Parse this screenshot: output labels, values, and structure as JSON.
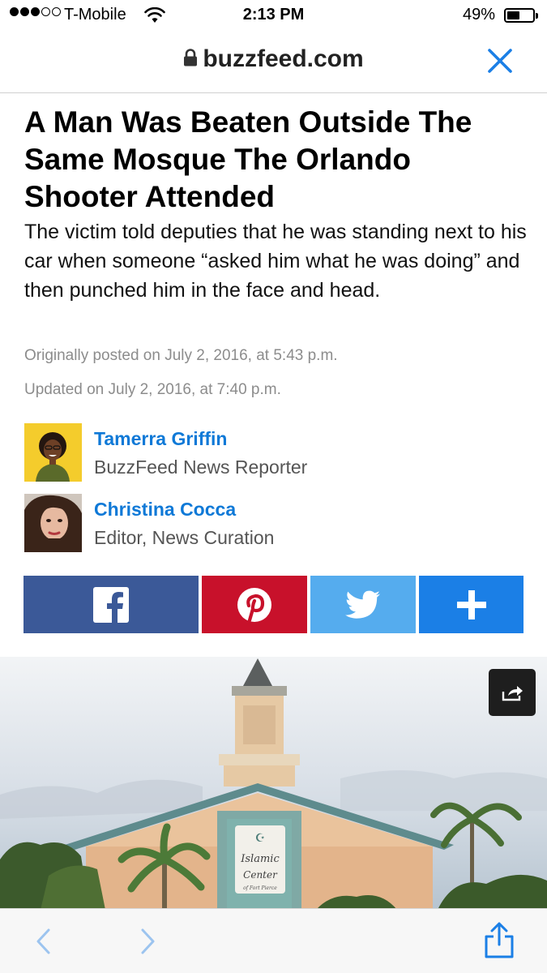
{
  "status_bar": {
    "carrier": "T-Mobile",
    "time": "2:13 PM",
    "battery_percent": "49%",
    "battery_level": 0.49,
    "signal_bars": 3,
    "signal_max": 5
  },
  "url_bar": {
    "domain": "buzzfeed.com",
    "icons": [
      "lock-icon",
      "close-icon"
    ]
  },
  "article": {
    "headline": "A Man Was Beaten Outside The Same Mosque The Orlando Shooter Attended",
    "dek": "The victim told deputies that he was standing next to his car when someone “asked him what he was doing” and then punched him in the face and head.",
    "posted": "Originally posted on July 2, 2016, at 5:43 p.m.",
    "updated": "Updated on July 2, 2016, at 7:40 p.m."
  },
  "bylines": [
    {
      "name": "Tamerra Griffin",
      "role": "BuzzFeed News Reporter"
    },
    {
      "name": "Christina Cocca",
      "role": "Editor, News Curation"
    }
  ],
  "share_buttons": [
    {
      "network": "facebook",
      "icon": "facebook-icon",
      "color": "#3b5998"
    },
    {
      "network": "pinterest",
      "icon": "pinterest-icon",
      "color": "#c8112b"
    },
    {
      "network": "twitter",
      "icon": "twitter-icon",
      "color": "#55acee"
    },
    {
      "network": "more",
      "icon": "plus-icon",
      "color": "#1b7fe6"
    }
  ],
  "hero_image": {
    "sign_line1": "Islamic",
    "sign_line2": "Center",
    "sign_line3": "of Fort Pierce"
  },
  "toolbar": {
    "icons": [
      "back-icon",
      "forward-icon",
      "share-icon"
    ]
  },
  "colors": {
    "link": "#0f79d7",
    "meta_gray": "#8c8c8c",
    "ios_blue": "#1b7fe6"
  }
}
